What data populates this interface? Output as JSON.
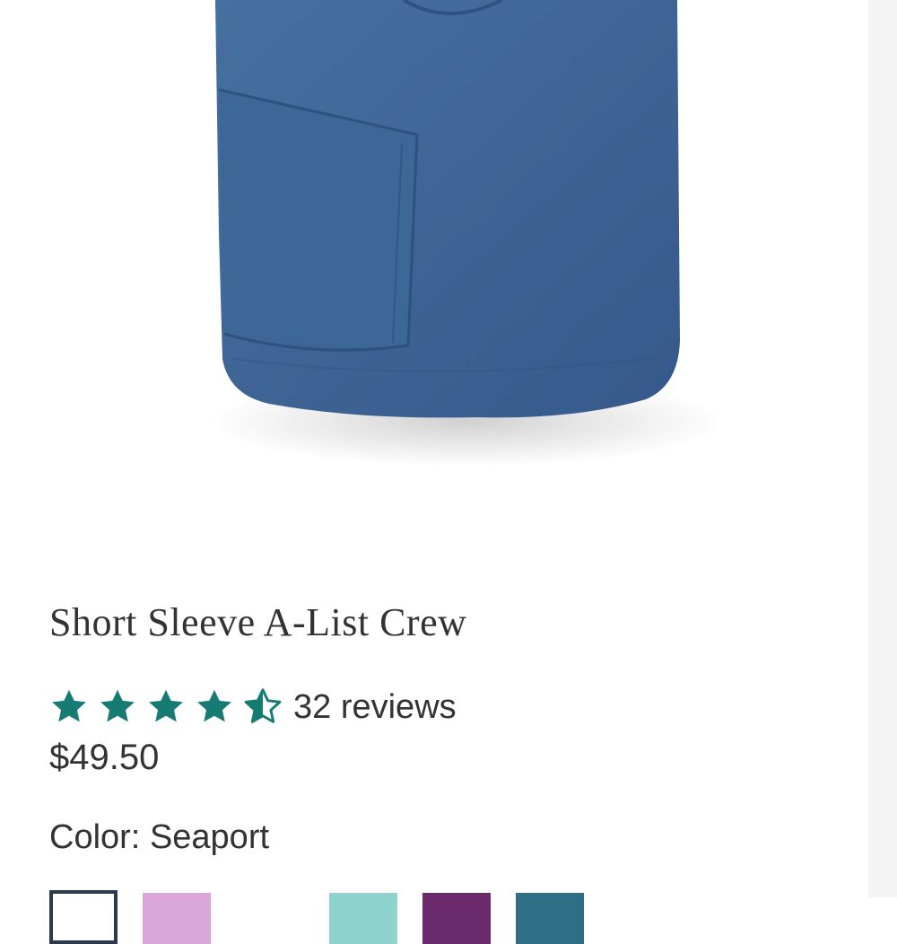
{
  "product": {
    "title": "Short Sleeve A-List Crew",
    "rating": 4.5,
    "rating_max": 5,
    "reviews_label": "32 reviews",
    "price": "$49.50",
    "color_label": "Color:",
    "color_value": "Seaport"
  },
  "icons": {
    "star_full": "star-icon",
    "star_half": "star-half-icon"
  },
  "colors": {
    "accent_star": "#167b73",
    "shirt": "#3f6594",
    "swatches": [
      "#ffffff",
      "#d9a6d8",
      "#8fd3cf",
      "#6b2a6b",
      "#2f6f86"
    ]
  }
}
